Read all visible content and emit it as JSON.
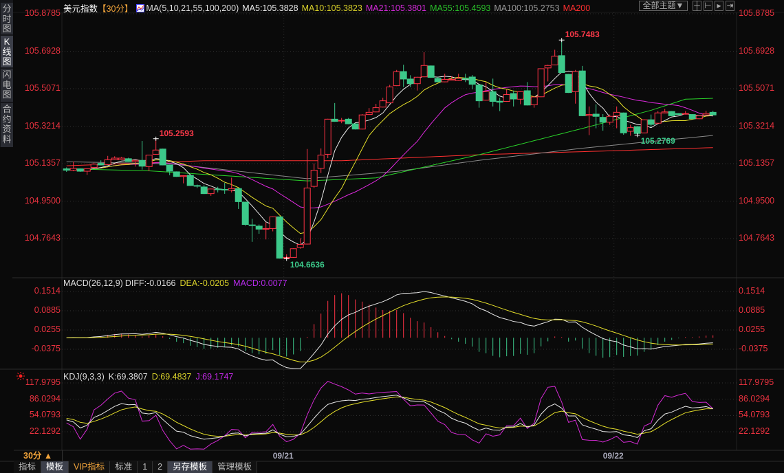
{
  "sidebar": {
    "tabs": [
      {
        "label": "分时图",
        "active": false
      },
      {
        "label": "K线图",
        "active": true
      },
      {
        "label": "闪电图",
        "active": false
      },
      {
        "label": "合约资料",
        "active": false
      }
    ]
  },
  "header": {
    "instrument": "美元指数",
    "period_tag": "【30分】",
    "ma_title": "MA(5,10,21,55,100,200)",
    "ma5": "MA5:105.3828",
    "ma10": "MA10:105.3823",
    "ma21": "MA21:105.3801",
    "ma55": "MA55:105.4593",
    "ma100": "MA100:105.2753",
    "ma200": "MA200",
    "theme_button": "全部主题▼",
    "tool_icons": [
      "crosshair-icon",
      "fit-range-icon",
      "play-forward-icon",
      "jump-end-icon"
    ]
  },
  "colors": {
    "up": "#ff3345",
    "down": "#3cc98a",
    "ma5": "#e8e8e8",
    "ma10": "#e6e02a",
    "ma21": "#e02ae0",
    "ma55": "#2ad42a",
    "ma100": "#8a8a8a",
    "ma200": "#ff3030",
    "axis": "#e8323f"
  },
  "chart_data": {
    "type": "candlestick",
    "period": "30分",
    "price_axis_ticks": [
      "105.8785",
      "105.6928",
      "105.5071",
      "105.3214",
      "105.1357",
      "104.9500",
      "104.7643"
    ],
    "price_range": [
      104.7643,
      105.8785
    ],
    "candles_ochl": [
      [
        105.11,
        105.103,
        105.117,
        105.095
      ],
      [
        105.103,
        105.112,
        105.146,
        105.098
      ],
      [
        105.11,
        105.098,
        105.112,
        105.095
      ],
      [
        105.098,
        105.11,
        105.112,
        105.08
      ],
      [
        105.117,
        105.133,
        105.14,
        105.115
      ],
      [
        105.137,
        105.129,
        105.152,
        105.127
      ],
      [
        105.131,
        105.155,
        105.174,
        105.129
      ],
      [
        105.155,
        105.163,
        105.172,
        105.153
      ],
      [
        105.155,
        105.163,
        105.169,
        105.153
      ],
      [
        105.16,
        105.146,
        105.165,
        105.144
      ],
      [
        105.146,
        105.152,
        105.155,
        105.121
      ],
      [
        105.152,
        105.123,
        105.248,
        105.106
      ],
      [
        105.121,
        105.178,
        105.18,
        105.098
      ],
      [
        105.182,
        105.203,
        105.2593,
        105.18
      ],
      [
        105.208,
        105.129,
        105.21,
        105.127
      ],
      [
        105.129,
        105.098,
        105.131,
        105.078
      ],
      [
        105.095,
        105.072,
        105.097,
        105.07
      ],
      [
        105.072,
        105.076,
        105.078,
        105.038
      ],
      [
        105.078,
        105.027,
        105.08,
        105.025
      ],
      [
        105.027,
        105.024,
        105.032,
        105.015
      ],
      [
        105.02,
        104.987,
        105.029,
        104.985
      ],
      [
        104.987,
        105.01,
        105.012,
        104.976
      ],
      [
        105.01,
        105.007,
        105.021,
        104.993
      ],
      [
        105.008,
        105.007,
        105.04,
        104.986
      ],
      [
        105.004,
        105.012,
        105.066,
        104.993
      ],
      [
        105.012,
        104.947,
        105.014,
        104.911
      ],
      [
        104.945,
        104.834,
        104.947,
        104.828
      ],
      [
        104.832,
        104.83,
        104.862,
        104.748
      ],
      [
        104.826,
        104.811,
        104.834,
        104.788
      ],
      [
        104.811,
        104.814,
        104.845,
        104.76
      ],
      [
        104.814,
        104.872,
        104.874,
        104.8
      ],
      [
        104.872,
        104.667,
        104.874,
        104.665
      ],
      [
        104.668,
        104.671,
        104.686,
        104.6636
      ],
      [
        104.671,
        104.714,
        104.716,
        104.669
      ],
      [
        104.72,
        104.735,
        104.766,
        104.714
      ],
      [
        104.737,
        105.015,
        105.208,
        104.735
      ],
      [
        105.023,
        105.103,
        105.137,
        105.015
      ],
      [
        105.112,
        105.178,
        105.211,
        105.089
      ],
      [
        105.182,
        105.356,
        105.358,
        105.163
      ],
      [
        105.356,
        105.345,
        105.436,
        105.343
      ],
      [
        105.348,
        105.35,
        105.362,
        105.336
      ],
      [
        105.356,
        105.333,
        105.362,
        105.331
      ],
      [
        105.333,
        105.307,
        105.335,
        105.305
      ],
      [
        105.307,
        105.377,
        105.381,
        105.305
      ],
      [
        105.379,
        105.39,
        105.411,
        105.377
      ],
      [
        105.392,
        105.413,
        105.432,
        105.39
      ],
      [
        105.416,
        105.447,
        105.462,
        105.414
      ],
      [
        105.437,
        105.516,
        105.526,
        105.435
      ],
      [
        105.522,
        105.591,
        105.6,
        105.52
      ],
      [
        105.592,
        105.555,
        105.626,
        105.515
      ],
      [
        105.555,
        105.532,
        105.574,
        105.515
      ],
      [
        105.532,
        105.564,
        105.566,
        105.498
      ],
      [
        105.566,
        105.622,
        105.688,
        105.564
      ],
      [
        105.62,
        105.563,
        105.622,
        105.561
      ],
      [
        105.558,
        105.541,
        105.566,
        105.539
      ],
      [
        105.541,
        105.553,
        105.581,
        105.539
      ],
      [
        105.551,
        105.553,
        105.568,
        105.549
      ],
      [
        105.547,
        105.558,
        105.581,
        105.545
      ],
      [
        105.558,
        105.557,
        105.581,
        105.54
      ],
      [
        105.565,
        105.529,
        105.575,
        105.504
      ],
      [
        105.526,
        105.447,
        105.528,
        105.413
      ],
      [
        105.45,
        105.492,
        105.54,
        105.448
      ],
      [
        105.492,
        105.444,
        105.557,
        105.419
      ],
      [
        105.445,
        105.44,
        105.463,
        105.396
      ],
      [
        105.444,
        105.478,
        105.504,
        105.442
      ],
      [
        105.483,
        105.456,
        105.498,
        105.419
      ],
      [
        105.455,
        105.492,
        105.494,
        105.43
      ],
      [
        105.497,
        105.426,
        105.54,
        105.424
      ],
      [
        105.427,
        105.466,
        105.468,
        105.413
      ],
      [
        105.467,
        105.606,
        105.608,
        105.465
      ],
      [
        105.61,
        105.622,
        105.626,
        105.543
      ],
      [
        105.625,
        105.668,
        105.7,
        105.623
      ],
      [
        105.671,
        105.587,
        105.7483,
        105.585
      ],
      [
        105.578,
        105.488,
        105.58,
        105.486
      ],
      [
        105.492,
        105.592,
        105.6,
        105.433
      ],
      [
        105.595,
        105.373,
        105.62,
        105.371
      ],
      [
        105.373,
        105.379,
        105.419,
        105.277
      ],
      [
        105.381,
        105.37,
        105.43,
        105.311
      ],
      [
        105.365,
        105.341,
        105.381,
        105.299
      ],
      [
        105.341,
        105.37,
        105.379,
        105.328
      ],
      [
        105.373,
        105.39,
        105.419,
        105.311
      ],
      [
        105.387,
        105.288,
        105.389,
        105.279
      ],
      [
        105.296,
        105.314,
        105.328,
        105.274
      ],
      [
        105.319,
        105.285,
        105.321,
        105.2769
      ],
      [
        105.288,
        105.353,
        105.355,
        105.286
      ],
      [
        105.353,
        105.33,
        105.379,
        105.316
      ],
      [
        105.336,
        105.387,
        105.396,
        105.334
      ],
      [
        105.387,
        105.392,
        105.407,
        105.385
      ],
      [
        105.394,
        105.373,
        105.396,
        105.371
      ],
      [
        105.384,
        105.379,
        105.386,
        105.377
      ],
      [
        105.381,
        105.384,
        105.396,
        105.379
      ],
      [
        105.379,
        105.358,
        105.381,
        105.356
      ],
      [
        105.358,
        105.373,
        105.375,
        105.356
      ],
      [
        105.377,
        105.384,
        105.398,
        105.375
      ],
      [
        105.39,
        105.377,
        105.398,
        105.375
      ]
    ],
    "ma_long": {
      "ma55": [
        [
          0,
          105.11
        ],
        [
          12,
          105.1
        ],
        [
          35,
          105.05
        ],
        [
          45,
          105.065
        ],
        [
          60,
          105.18
        ],
        [
          75,
          105.31
        ],
        [
          85,
          105.4
        ],
        [
          90,
          105.455
        ],
        [
          94,
          105.4593
        ]
      ],
      "ma100": [
        [
          0,
          105.145
        ],
        [
          15,
          105.135
        ],
        [
          35,
          105.061
        ],
        [
          48,
          105.097
        ],
        [
          60,
          105.152
        ],
        [
          75,
          105.212
        ],
        [
          94,
          105.2753
        ]
      ],
      "ma200": [
        [
          0,
          105.125
        ],
        [
          20,
          105.15
        ],
        [
          40,
          105.15
        ],
        [
          60,
          105.18
        ],
        [
          80,
          105.2
        ],
        [
          94,
          105.215
        ]
      ]
    },
    "annotations": [
      {
        "candle": 13,
        "text": "105.2593",
        "kind": "high"
      },
      {
        "candle": 32,
        "text": "104.6636",
        "kind": "low"
      },
      {
        "candle": 72,
        "text": "105.7483",
        "kind": "high"
      },
      {
        "candle": 83,
        "text": "105.2769",
        "kind": "low"
      }
    ],
    "dates": [
      {
        "candle": 31.6,
        "text": "09/21"
      },
      {
        "candle": 79.6,
        "text": "09/22"
      }
    ]
  },
  "macd": {
    "title": "MACD(26,12,9)",
    "diff": "DIFF:-0.0166",
    "dea": "DEA:-0.0205",
    "macd": "MACD:0.0077",
    "ticks": [
      "0.1514",
      "0.0885",
      "0.0255",
      "-0.0375"
    ],
    "range": [
      -0.0375,
      0.1514
    ]
  },
  "kdj": {
    "title": "KDJ(9,3,3)",
    "k": "K:69.3807",
    "d": "D:69.4837",
    "j": "J:69.1747",
    "ticks": [
      "117.9795",
      "86.0294",
      "54.0793",
      "22.1292"
    ],
    "range": [
      22.1292,
      117.9795
    ]
  },
  "footer": {
    "period_selector": "30分 ▲",
    "tabs": [
      {
        "label": "指标",
        "style": ""
      },
      {
        "label": "模板",
        "style": "hl"
      },
      {
        "label": "VIP指标",
        "style": "vip"
      },
      {
        "label": "标准",
        "style": ""
      },
      {
        "label": "1",
        "style": ""
      },
      {
        "label": "2",
        "style": ""
      },
      {
        "label": "另存模板",
        "style": "hl"
      },
      {
        "label": "管理模板",
        "style": ""
      }
    ]
  }
}
